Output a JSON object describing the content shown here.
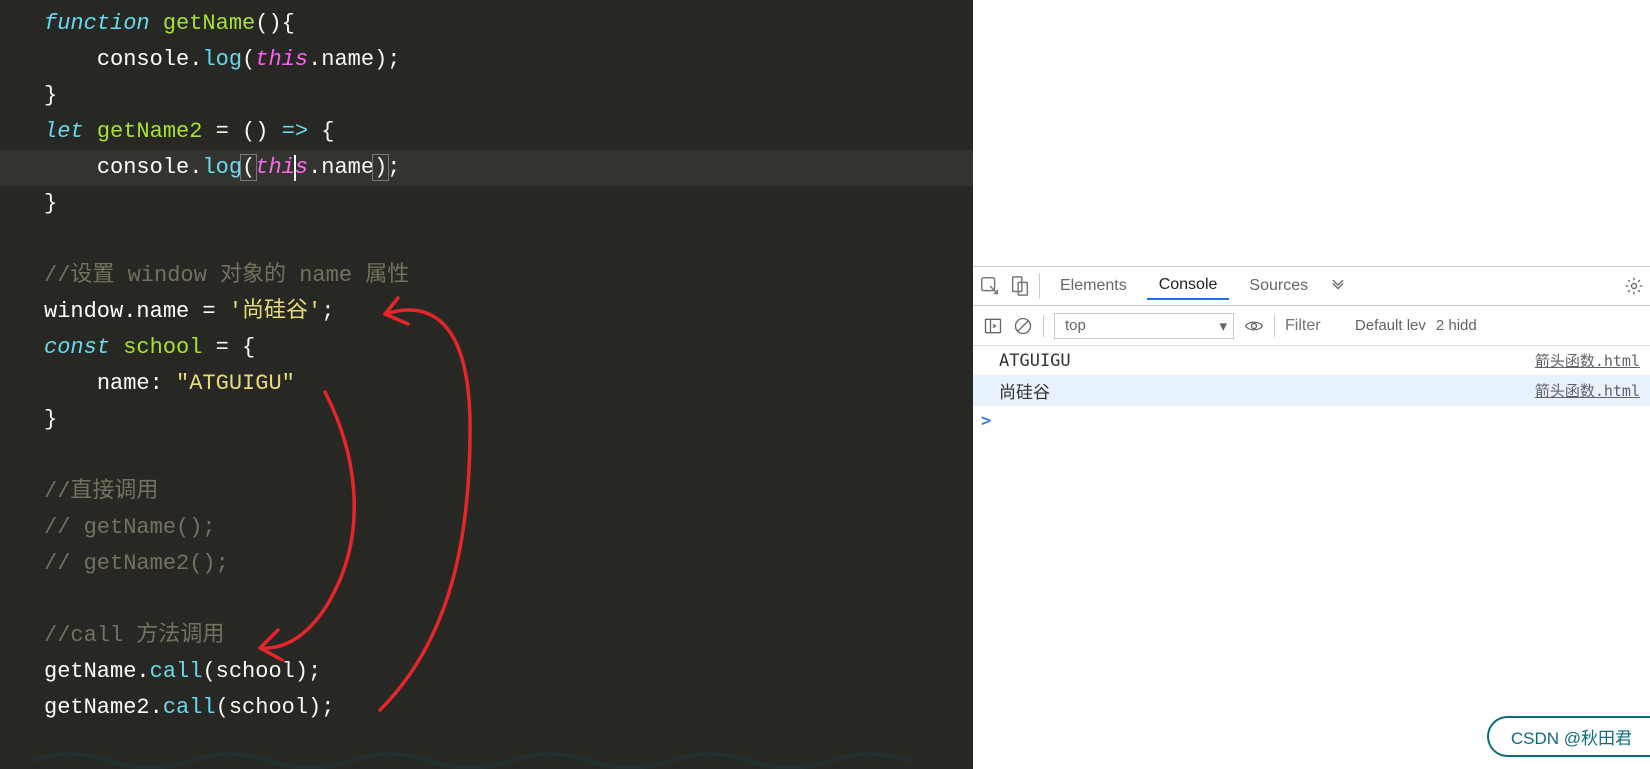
{
  "editor": {
    "code_l1_a": "function",
    "code_l1_b": "getName",
    "code_l1_c": "(){",
    "code_l2_a": "console",
    "code_l2_b": ".",
    "code_l2_c": "log",
    "code_l2_d": "(",
    "code_l2_e": "this",
    "code_l2_f": ".name);",
    "code_l3": "}",
    "code_l4_a": "let",
    "code_l4_b": "getName2",
    "code_l4_c": " = ",
    "code_l4_d": "()",
    "code_l4_e": " => ",
    "code_l4_f": "{",
    "code_l5_a": "console",
    "code_l5_b": ".",
    "code_l5_c": "log",
    "code_l5_d": "(",
    "code_l5_e": "this",
    "code_l5_f": ".name",
    "code_l5_g": ")",
    "code_l5_h": ";",
    "code_l6": "}",
    "code_l8": "//设置 window 对象的 name 属性",
    "code_l9_a": "window.name = ",
    "code_l9_b": "'尚硅谷'",
    "code_l9_c": ";",
    "code_l10_a": "const",
    "code_l10_b": "school",
    "code_l10_c": " = {",
    "code_l11_a": "name: ",
    "code_l11_b": "\"ATGUIGU\"",
    "code_l12": "}",
    "code_l14": "//直接调用",
    "code_l15": "// getName();",
    "code_l16": "// getName2();",
    "code_l18": "//call 方法调用",
    "code_l19_a": "getName.",
    "code_l19_b": "call",
    "code_l19_c": "(school);",
    "code_l20_a": "getName2.",
    "code_l20_b": "call",
    "code_l20_c": "(school);"
  },
  "devtools": {
    "tabs": {
      "elements": "Elements",
      "console": "Console",
      "sources": "Sources"
    },
    "toolbar": {
      "context": "top",
      "filter_placeholder": "Filter",
      "loglevel": "Default lev",
      "hidden": "2 hidd"
    },
    "output": [
      {
        "msg": "ATGUIGU",
        "src": "箭头函数.html",
        "selected": false
      },
      {
        "msg": "尚硅谷",
        "src": "箭头函数.html",
        "selected": true
      }
    ],
    "prompt": ">"
  },
  "watermark": "CSDN @秋田君"
}
